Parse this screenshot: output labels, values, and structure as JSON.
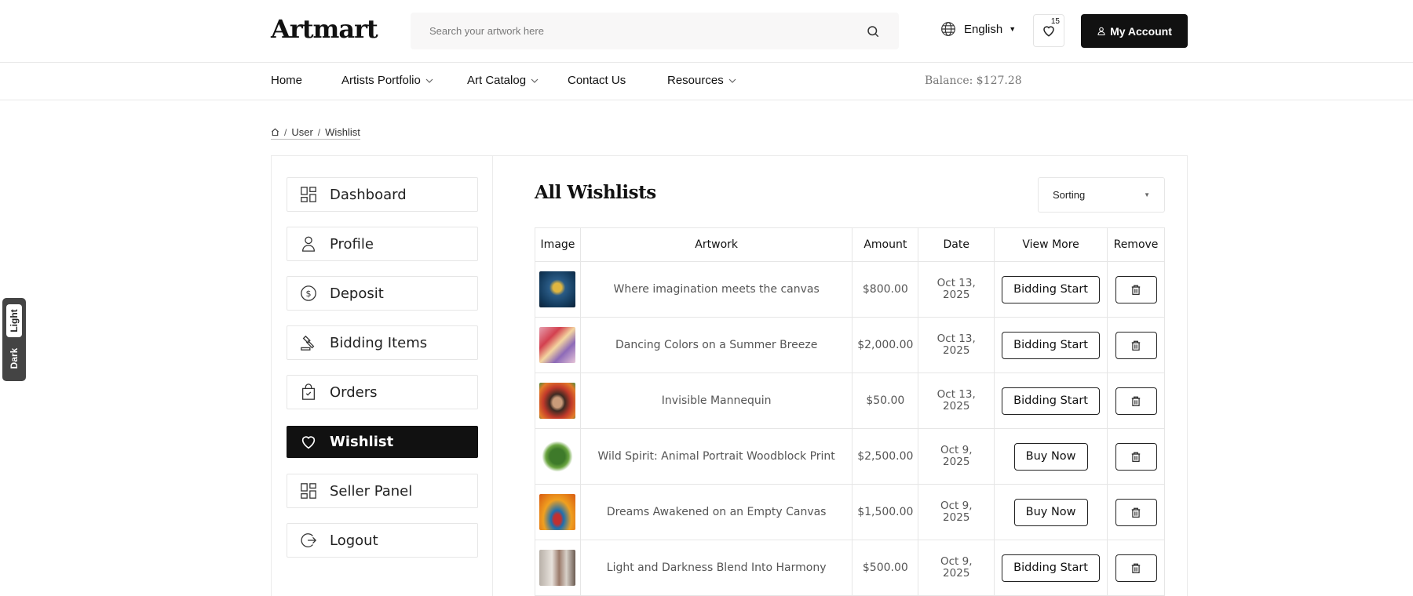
{
  "header": {
    "logo": "Artmart",
    "search_placeholder": "Search your artwork here",
    "language": "English",
    "wishlist_count": "15",
    "account_label": "My Account"
  },
  "nav": {
    "items": [
      "Home",
      "Artists Portfolio",
      "Art Catalog",
      "Contact Us",
      "Resources"
    ],
    "balance": "Balance: $127.28"
  },
  "breadcrumb": {
    "user": "User",
    "current": "Wishlist"
  },
  "sidebar": {
    "items": [
      "Dashboard",
      "Profile",
      "Deposit",
      "Bidding Items",
      "Orders",
      "Wishlist",
      "Seller Panel",
      "Logout"
    ],
    "active": "Wishlist"
  },
  "content": {
    "title": "All Wishlists",
    "sorting_label": "Sorting",
    "columns": [
      "Image",
      "Artwork",
      "Amount",
      "Date",
      "View More",
      "Remove"
    ],
    "rows": [
      {
        "artwork": "Where imagination meets the canvas",
        "amount": "$800.00",
        "date_line1": "Oct 13,",
        "date_line2": "2025",
        "action": "Bidding Start"
      },
      {
        "artwork": "Dancing Colors on a Summer Breeze",
        "amount": "$2,000.00",
        "date_line1": "Oct 13,",
        "date_line2": "2025",
        "action": "Bidding Start"
      },
      {
        "artwork": "Invisible Mannequin",
        "amount": "$50.00",
        "date_line1": "Oct 13,",
        "date_line2": "2025",
        "action": "Bidding Start"
      },
      {
        "artwork": "Wild Spirit: Animal Portrait Woodblock Print",
        "amount": "$2,500.00",
        "date_line1": "Oct 9,",
        "date_line2": "2025",
        "action": "Buy Now"
      },
      {
        "artwork": "Dreams Awakened on an Empty Canvas",
        "amount": "$1,500.00",
        "date_line1": "Oct 9,",
        "date_line2": "2025",
        "action": "Buy Now"
      },
      {
        "artwork": "Light and Darkness Blend Into Harmony",
        "amount": "$500.00",
        "date_line1": "Oct 9,",
        "date_line2": "2025",
        "action": "Bidding Start"
      }
    ]
  },
  "theme_toggle": {
    "light": "Light",
    "dark": "Dark"
  }
}
